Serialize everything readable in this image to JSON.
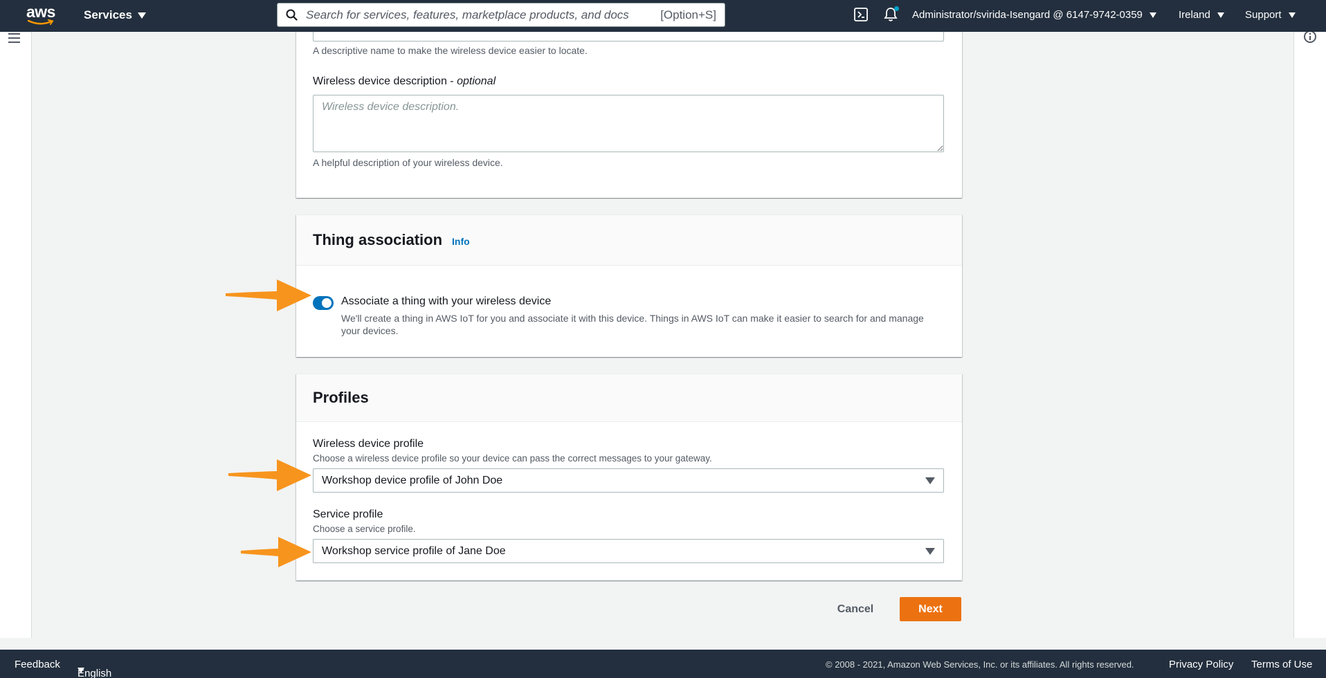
{
  "nav": {
    "logo_text": "aws",
    "services_label": "Services",
    "search_placeholder": "Search for services, features, marketplace products, and docs",
    "search_shortcut": "[Option+S]",
    "account_label": "Administrator/svirida-Isengard @ 6147-9742-0359",
    "region_label": "Ireland",
    "support_label": "Support"
  },
  "device_details": {
    "name_hint": "A descriptive name to make the wireless device easier to locate.",
    "description_label": "Wireless device description - ",
    "description_optional": "optional",
    "description_placeholder": "Wireless device description.",
    "description_hint": "A helpful description of your wireless device."
  },
  "thing_association": {
    "title": "Thing association",
    "info_link": "Info",
    "toggle_label": "Associate a thing with your wireless device",
    "toggle_on": true,
    "toggle_description": "We'll create a thing in AWS IoT for you and associate it with this device. Things in AWS IoT can make it easier to search for and manage your devices."
  },
  "profiles": {
    "title": "Profiles",
    "device_profile_label": "Wireless device profile",
    "device_profile_hint": "Choose a wireless device profile so your device can pass the correct messages to your gateway.",
    "device_profile_value": "Workshop device profile of John Doe",
    "service_profile_label": "Service profile",
    "service_profile_hint": "Choose a service profile.",
    "service_profile_value": "Workshop service profile of Jane Doe"
  },
  "actions": {
    "cancel_label": "Cancel",
    "next_label": "Next"
  },
  "footer": {
    "feedback": "Feedback",
    "language": "English (US)",
    "copyright": "© 2008 - 2021, Amazon Web Services, Inc. or its affiliates. All rights reserved.",
    "privacy": "Privacy Policy",
    "terms": "Terms of Use"
  },
  "colors": {
    "nav_bg": "#232f3e",
    "primary_button": "#ec7211",
    "toggle_on": "#0073bb",
    "annotation_arrow": "#f7941d"
  }
}
